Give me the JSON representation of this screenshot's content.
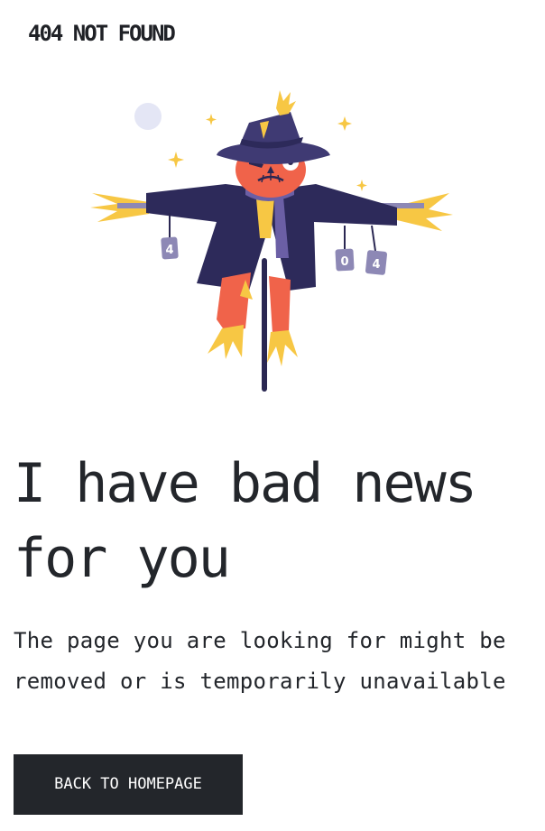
{
  "header": {
    "brand": "404 NOT FOUND"
  },
  "illustration": {
    "name": "scarecrow",
    "can_labels": [
      "4",
      "0",
      "4"
    ],
    "colors": {
      "hat": "#3f3a73",
      "coat": "#2d2a5a",
      "face": "#f0634a",
      "straw": "#f7c744",
      "pants": "#f0634a",
      "scarf": "#6b5fa5",
      "pole": "#2a2752",
      "moon": "#e4e6f5"
    }
  },
  "main": {
    "headline": "I have bad news for you",
    "subtext": "The page you are looking for might be removed or is temporarily unavailable",
    "home_button_label": "BACK TO HOMEPAGE"
  }
}
